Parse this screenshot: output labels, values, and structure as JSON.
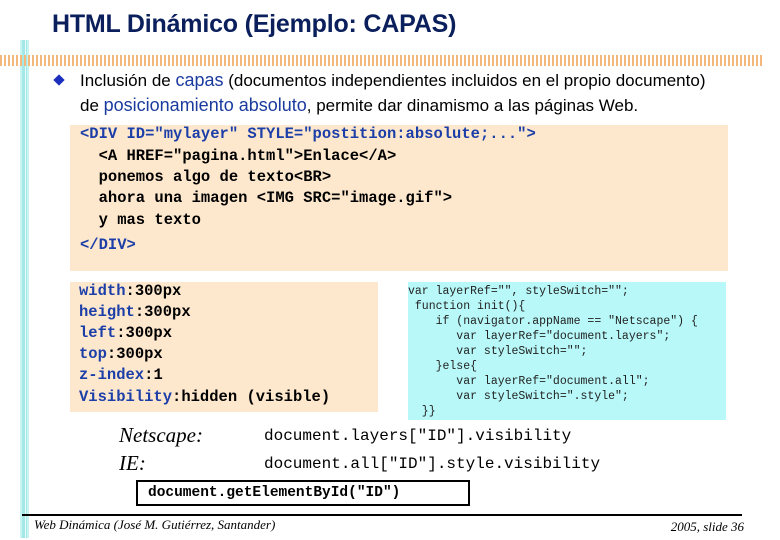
{
  "slide": {
    "title": "HTML Dinámico (Ejemplo: CAPAS)",
    "bullet": {
      "part1": "Inclusión de ",
      "highlight1": "capas",
      "part2": " (documentos independientes incluidos en el propio documento)",
      "part3": "de ",
      "highlight2": "posicionamiento absoluto",
      "part4": ", permite dar dinamismo a las páginas Web."
    },
    "html_code": {
      "line1": "<DIV ID=\"mylayer\" STYLE=\"postition:absolute;...\">",
      "line2": "  <A HREF=\"pagina.html\">Enlace</A>",
      "line3": "  ponemos algo de texto<BR>",
      "line4": "  ahora una imagen <IMG SRC=\"image.gif\">",
      "line5": "  y mas texto",
      "line6": "</DIV>"
    },
    "style_props": [
      {
        "name": "width",
        "value": "300px"
      },
      {
        "name": "height",
        "value": "300px"
      },
      {
        "name": "left",
        "value": "300px"
      },
      {
        "name": "top",
        "value": "300px"
      },
      {
        "name": "z-index",
        "value": "1"
      },
      {
        "name": "Visibility",
        "value": "hidden (visible)"
      }
    ],
    "js_code": [
      "var layerRef=\"\", styleSwitch=\"\";",
      " function init(){",
      "    if (navigator.appName == \"Netscape\") {",
      "       var layerRef=\"document.layers\";",
      "       var styleSwitch=\"\";",
      "    }else{",
      "       var layerRef=\"document.all\";",
      "       var styleSwitch=\".style\";",
      "  }}"
    ],
    "browsers": [
      {
        "label": "Netscape:",
        "api": "document.layers[\"ID\"].visibility"
      },
      {
        "label": "IE:",
        "api": "document.all[\"ID\"].style.visibility"
      }
    ],
    "dom_api": "document.getElementById(\"ID\")",
    "footer": {
      "left": "Web Dinámica (José M. Gutiérrez, Santander)",
      "right": "2005, slide 36"
    }
  },
  "colors": {
    "title": "#0a1f5c",
    "highlight": "#1b3a9e",
    "code_bg_html": "#fde8cd",
    "code_bg_js": "#b8f8f8",
    "rule_dots": "#f2b87e",
    "side_bar": "#a6e8e8"
  }
}
